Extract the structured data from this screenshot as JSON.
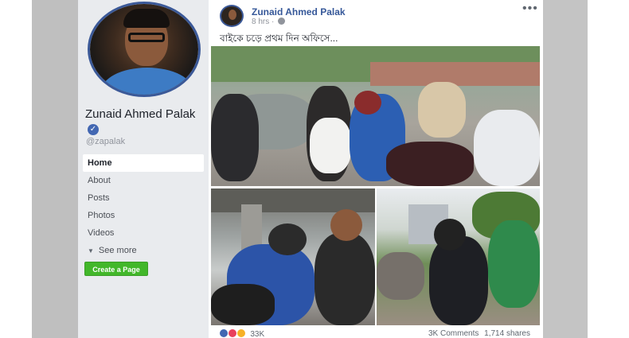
{
  "profile": {
    "name": "Zunaid Ahmed Palak",
    "verified_icon": "verified-badge-icon",
    "username": "@zapalak"
  },
  "nav": {
    "items": [
      {
        "label": "Home",
        "active": true
      },
      {
        "label": "About",
        "active": false
      },
      {
        "label": "Posts",
        "active": false
      },
      {
        "label": "Photos",
        "active": false
      },
      {
        "label": "Videos",
        "active": false
      }
    ],
    "see_more": "See more",
    "create_page": "Create a Page"
  },
  "post": {
    "author": "Zunaid Ahmed Palak",
    "time": "8 hrs",
    "privacy_icon": "globe-icon",
    "text": "বাইকে চড়ে প্রথম দিন অফিসে...",
    "more_icon": "more-options-icon"
  },
  "engagement": {
    "reaction_icons": [
      "like-icon",
      "love-icon",
      "haha-icon"
    ],
    "reaction_count": "33K",
    "comments": "3K Comments",
    "shares": "1,714 shares"
  },
  "colors": {
    "brand": "#3b5998",
    "link": "#365899",
    "create_button": "#42b72a",
    "sidebar_bg": "#e9ebee"
  }
}
